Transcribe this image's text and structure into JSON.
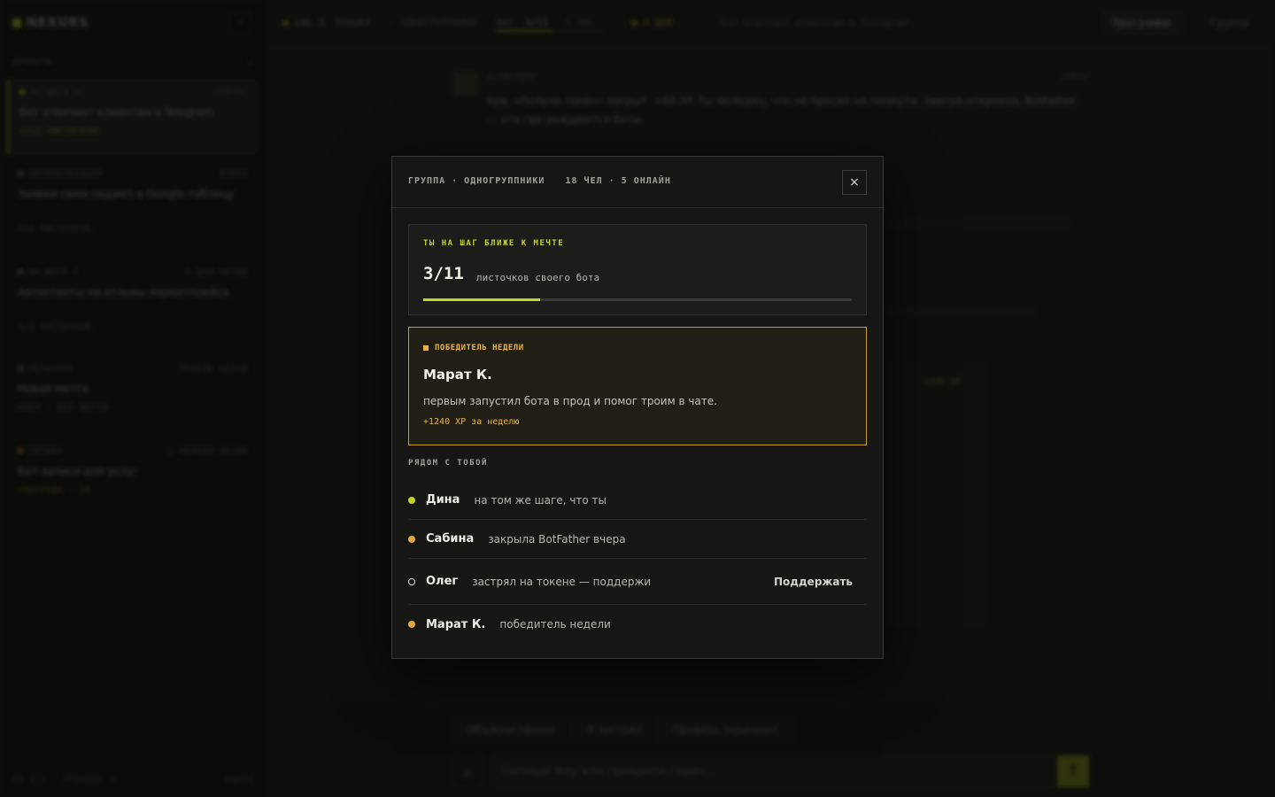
{
  "app": {
    "logo": "NEXURS",
    "collapse_icon": "chevron-left-icon",
    "section_label": "ПРОЕКТЫ",
    "section_add": "+",
    "projects": [
      {
        "tag": "НА ШАГЕ 3",
        "time": "СЕЙЧАС",
        "name": "Бот отвечает клиентам в Telegram",
        "meta": "3/11 ЛИСТОЧКОВ",
        "active": true
      },
      {
        "tag": "АВТОМАТИЗАЦИЯ",
        "time": "ВЧЕРА",
        "name": "Заявки сами падают в Google-таблицу",
        "meta": "2/8 ЛИСТОЧКОВ",
        "active": false
      },
      {
        "tag": "НА ШАГЕ 1",
        "time": "3 ДНЯ НАЗАД",
        "name": "Автоответы на отзывы маркетплейса",
        "meta": "1/9 ЛИСТОЧКОВ",
        "active": false
      },
      {
        "tag": "ЧЕРНОВИК",
        "time": "НЕДЕЛЮ НАЗАД",
        "name": "Новая мечта",
        "meta": "ИДЕЯ · БЕЗ ШАГОВ",
        "active": false
      },
      {
        "tag": "ГОТОВО",
        "time": "2 НЕДЕЛИ НАЗАД",
        "name": "Бот-записи для услуг",
        "meta": "+НАГРАДА · XP",
        "active": false
      }
    ],
    "footer_left": "XP 412 · УРОВЕНЬ 3",
    "footer_right": "ВЫЙТИ"
  },
  "topbar": {
    "level": "LVL 3",
    "level_label": "ПЛАНКА",
    "level_sub": "· ОДНОГРУППНИКИ",
    "step_label": "ШАГ",
    "step_value": "3/11",
    "step_sub": "· 1 ЧАС",
    "streak": "● 4 ДНЯ",
    "goal": "Бот отвечает клиентам в Telegram",
    "tab_program": "Программа",
    "tab_group": "Группа"
  },
  "chat": {
    "msg_head": "АССИСТЕНТ",
    "msg_time": "СЕЙЧАС",
    "msg_text": "Ура, «Получи токен» закрыт. +60 XP. Ты молодец, что не бросил на полпути. Завтра откроешь BotFather — это где рождаются боты.",
    "reward": "+240 XP"
  },
  "composer": {
    "chip1": "Объясни проще",
    "chip2": "Я застрял",
    "chip3": "Проверь скриншот",
    "placeholder": "Напиши Аму или прикрепи скрин...",
    "attach_icon": "paperclip-icon",
    "send_icon": "arrow-up-icon"
  },
  "modal": {
    "title_group": "ГРУППА · ОДНОГРУППНИКИ",
    "title_stats": "18 ЧЕЛ · 5 ОНЛАЙН",
    "close_label": "×",
    "progress": {
      "kicker": "ТЫ НА ШАГ БЛИЖЕ К МЕЧТЕ",
      "count": "3/11",
      "desc": "листочков своего бота",
      "fraction": 0.2727
    },
    "winner": {
      "kicker": "ПОБЕДИТЕЛЬ НЕДЕЛИ",
      "name": "Марат К.",
      "desc": "первым запустил бота в прод и помог троим в чате.",
      "xp": "+1240 XP за неделю"
    },
    "near_title": "РЯДОМ С ТОБОЙ",
    "peers": [
      {
        "name": "Дина",
        "status": "на том же шаге, что ты",
        "dot_color": "#c6d422"
      },
      {
        "name": "Сабина",
        "status": "закрыла BotFather вчера",
        "dot_color": "#e9a83a"
      },
      {
        "name": "Олег",
        "status": "застрял на токене — поддержи",
        "dot_color": "hollow",
        "action": "Поддержать"
      },
      {
        "name": "Марат К.",
        "status": "победитель недели",
        "dot_color": "#e9a83a"
      }
    ]
  },
  "colors": {
    "accent": "#c6d422",
    "gold": "#e9b23f",
    "bg": "#111110",
    "modal_bg": "#161615"
  }
}
